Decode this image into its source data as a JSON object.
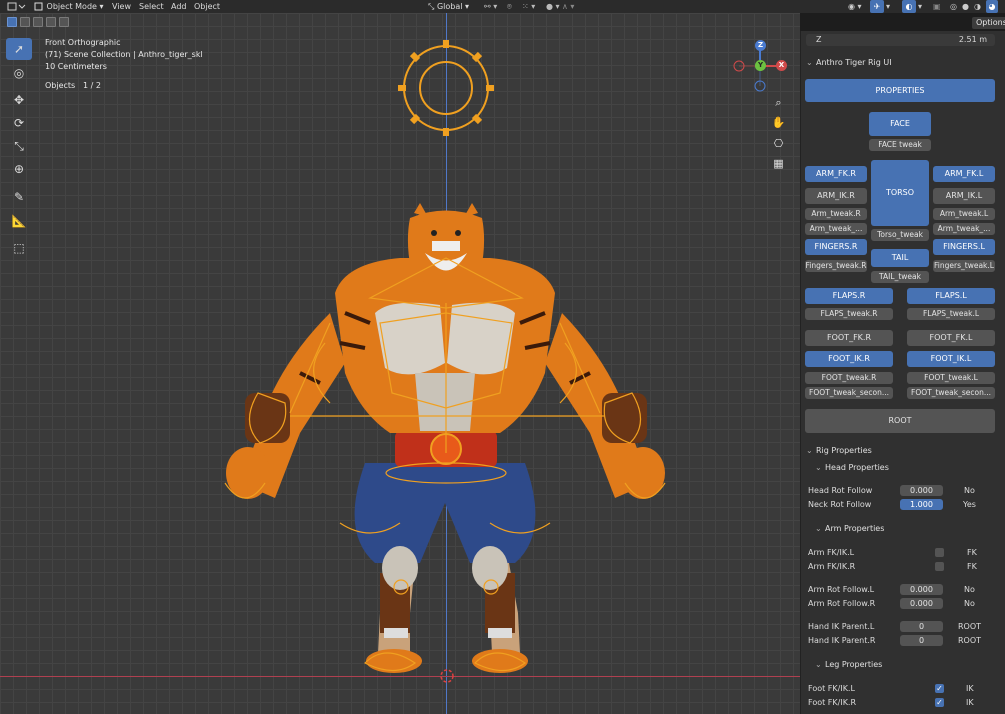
{
  "header": {
    "mode": "Object Mode",
    "menus": [
      "View",
      "Select",
      "Add",
      "Object"
    ],
    "orientation": "Global",
    "options_label": "Options"
  },
  "viewport": {
    "view_name": "Front Orthographic",
    "collection": "(71) Scene Collection | Anthro_tiger_skl",
    "grid_scale": "10 Centimeters",
    "objects_label": "Objects",
    "objects_count": "1 / 2",
    "gizmo": {
      "z": "Z",
      "y": "Y",
      "x": "X"
    }
  },
  "sidebar": {
    "z_label": "Z",
    "z_value": "2.51 m",
    "rig_ui_title": "Anthro Tiger Rig UI",
    "buttons": {
      "properties": "PROPERTIES",
      "face": "FACE",
      "face_tweak": "FACE tweak",
      "arm_fk_r": "ARM_FK.R",
      "arm_fk_l": "ARM_FK.L",
      "arm_ik_r": "ARM_IK.R",
      "arm_ik_l": "ARM_IK.L",
      "torso": "TORSO",
      "arm_tweak_r": "Arm_tweak.R",
      "arm_tweak_l": "Arm_tweak.L",
      "arm_tweak_r2": "Arm_tweak_...",
      "arm_tweak_l2": "Arm_tweak_...",
      "torso_tweak": "Torso_tweak",
      "fingers_r": "FINGERS.R",
      "fingers_l": "FINGERS.L",
      "tail": "TAIL",
      "fingers_tweak_r": "Fingers_tweak.R",
      "fingers_tweak_l": "Fingers_tweak.L",
      "tail_tweak": "TAIL_tweak",
      "flaps_r": "FLAPS.R",
      "flaps_l": "FLAPS.L",
      "flaps_tweak_r": "FLAPS_tweak.R",
      "flaps_tweak_l": "FLAPS_tweak.L",
      "foot_fk_r": "FOOT_FK.R",
      "foot_fk_l": "FOOT_FK.L",
      "foot_ik_r": "FOOT_IK.R",
      "foot_ik_l": "FOOT_IK.L",
      "foot_tweak_r": "FOOT_tweak.R",
      "foot_tweak_l": "FOOT_tweak.L",
      "foot_tweak_sec_r": "FOOT_tweak_secon...",
      "foot_tweak_sec_l": "FOOT_tweak_secon...",
      "root": "ROOT"
    },
    "rig_properties": "Rig Properties",
    "head_properties": "Head Properties",
    "head_rot_follow": {
      "label": "Head Rot Follow",
      "value": "0.000",
      "state": "No"
    },
    "neck_rot_follow": {
      "label": "Neck Rot Follow",
      "value": "1.000",
      "state": "Yes"
    },
    "arm_properties": "Arm Properties",
    "arm_fkik_l": {
      "label": "Arm FK/IK.L",
      "state": "FK"
    },
    "arm_fkik_r": {
      "label": "Arm FK/IK.R",
      "state": "FK"
    },
    "arm_rot_follow_l": {
      "label": "Arm Rot Follow.L",
      "value": "0.000",
      "state": "No"
    },
    "arm_rot_follow_r": {
      "label": "Arm Rot Follow.R",
      "value": "0.000",
      "state": "No"
    },
    "hand_ik_parent_l": {
      "label": "Hand IK Parent.L",
      "value": "0",
      "state": "ROOT"
    },
    "hand_ik_parent_r": {
      "label": "Hand IK Parent.R",
      "value": "0",
      "state": "ROOT"
    },
    "leg_properties": "Leg Properties",
    "foot_fkik_l": {
      "label": "Foot FK/IK.L",
      "state": "IK"
    },
    "foot_fkik_r": {
      "label": "Foot FK/IK.R",
      "state": "IK"
    }
  },
  "colors": {
    "accent": "#4772b3",
    "rig": "#f0a020",
    "tiger": "#e07a1a"
  }
}
